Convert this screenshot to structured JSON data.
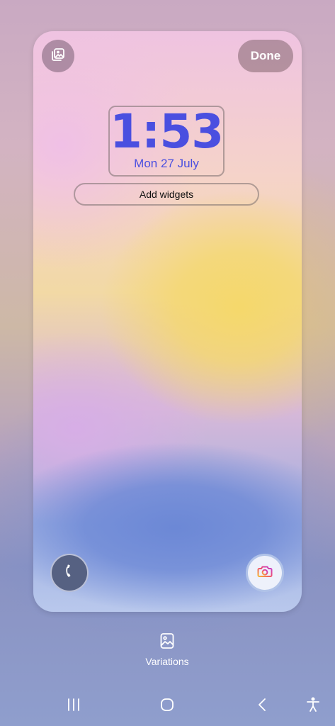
{
  "lockscreen": {
    "done_label": "Done",
    "time": "1:53",
    "date": "Mon 27 July",
    "add_widgets_label": "Add widgets"
  },
  "bottom": {
    "variations_label": "Variations"
  },
  "colors": {
    "clock": "#4a4fe0"
  }
}
